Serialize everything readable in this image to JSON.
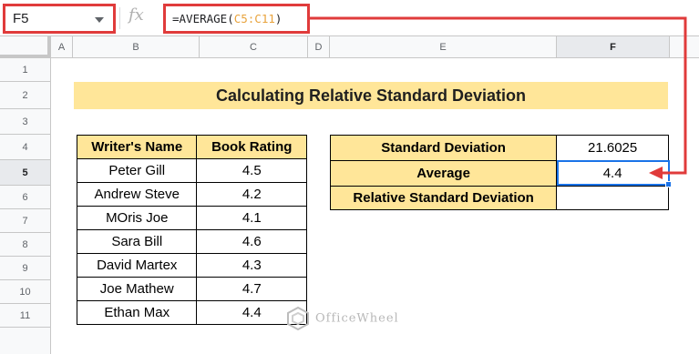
{
  "formula_bar": {
    "name_box": "F5",
    "fx_label": "fx",
    "formula_prefix": "=AVERAGE(",
    "formula_ref": "C5:C11",
    "formula_suffix": ")"
  },
  "columns": [
    "A",
    "B",
    "C",
    "D",
    "E",
    "F"
  ],
  "selected_column": "F",
  "rows": [
    "1",
    "2",
    "3",
    "4",
    "5",
    "6",
    "7",
    "8",
    "9",
    "10",
    "11"
  ],
  "selected_row": "5",
  "title": "Calculating Relative Standard Deviation",
  "writer_table": {
    "headers": [
      "Writer's Name",
      "Book Rating"
    ],
    "rows": [
      [
        "Peter Gill",
        "4.5"
      ],
      [
        "Andrew Steve",
        "4.2"
      ],
      [
        "MOris Joe",
        "4.1"
      ],
      [
        "Sara Bill",
        "4.6"
      ],
      [
        "David Martex",
        "4.3"
      ],
      [
        "Joe Mathew",
        "4.7"
      ],
      [
        "Ethan Max",
        "4.4"
      ]
    ]
  },
  "stats_table": {
    "rows": [
      [
        "Standard Deviation",
        "21.6025"
      ],
      [
        "Average",
        "4.4"
      ],
      [
        "Relative Standard Deviation",
        ""
      ]
    ]
  },
  "watermark": "OfficeWheel",
  "colors": {
    "header_fill": "#ffe699",
    "highlight_red": "#e03b3b",
    "selection_blue": "#1a73e8",
    "range_ref": "#e8a33c"
  }
}
